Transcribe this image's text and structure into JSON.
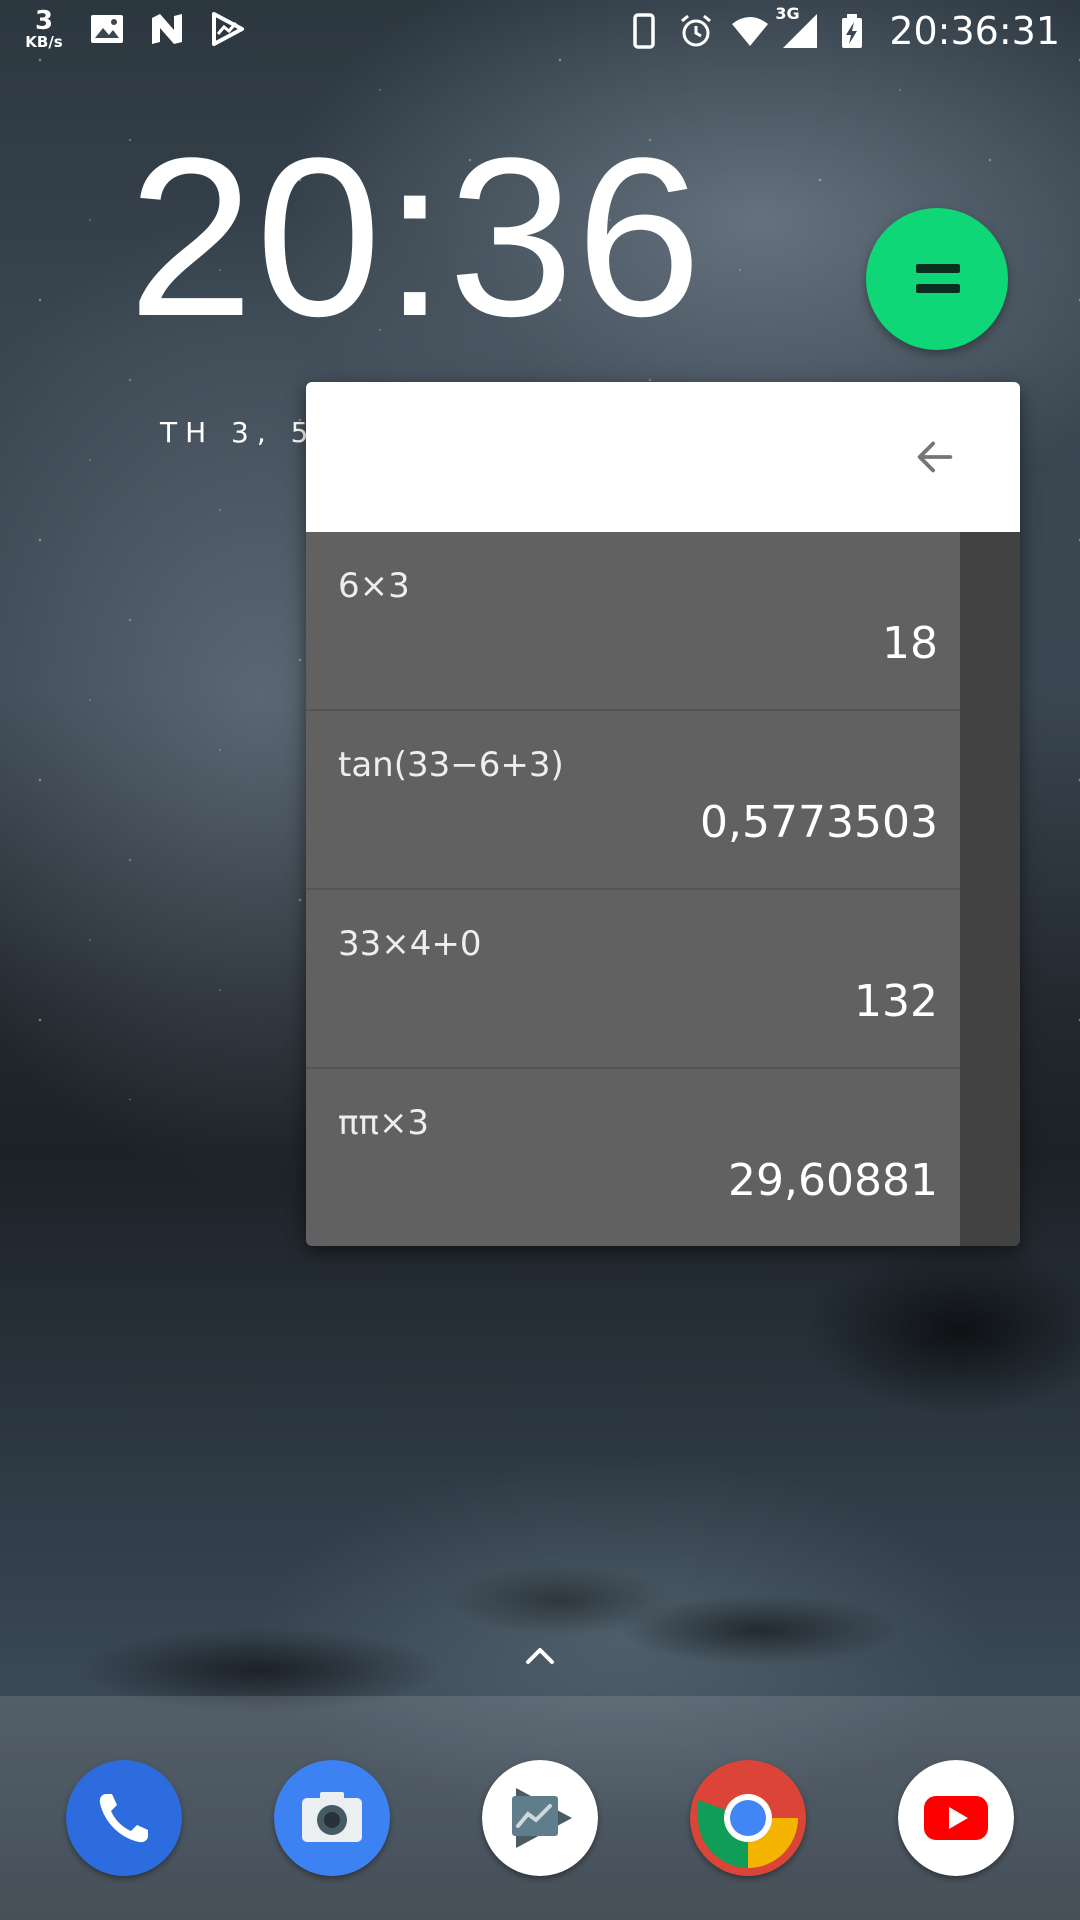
{
  "status_bar": {
    "net_speed_value": "3",
    "net_speed_unit": "KB/s",
    "network": "3G",
    "time": "20:36:31",
    "left_icons": [
      "image-icon",
      "n-icon",
      "play-trend-icon"
    ],
    "right_icons": [
      "phone-vibrate-icon",
      "alarm-icon",
      "wifi-icon",
      "signal-icon",
      "battery-charging-icon"
    ]
  },
  "lock_clock": {
    "time": "20:36",
    "date": "TH 3, 5"
  },
  "bubble": {
    "icon": "equals-icon",
    "color": "#0fd777"
  },
  "history": {
    "back_icon": "back-arrow-icon",
    "items": [
      {
        "expression": "6×3",
        "result": "18"
      },
      {
        "expression": "tan(33−6+3)",
        "result": "0,5773503"
      },
      {
        "expression": "33×4+0",
        "result": "132"
      },
      {
        "expression": "ππ×3",
        "result": "29,60881"
      }
    ]
  },
  "dock": {
    "apps": [
      {
        "name": "Phone",
        "icon": "phone-icon"
      },
      {
        "name": "Camera",
        "icon": "camera-icon"
      },
      {
        "name": "Play Console",
        "icon": "play-console-icon"
      },
      {
        "name": "Chrome",
        "icon": "chrome-icon"
      },
      {
        "name": "YouTube",
        "icon": "youtube-icon"
      }
    ]
  }
}
